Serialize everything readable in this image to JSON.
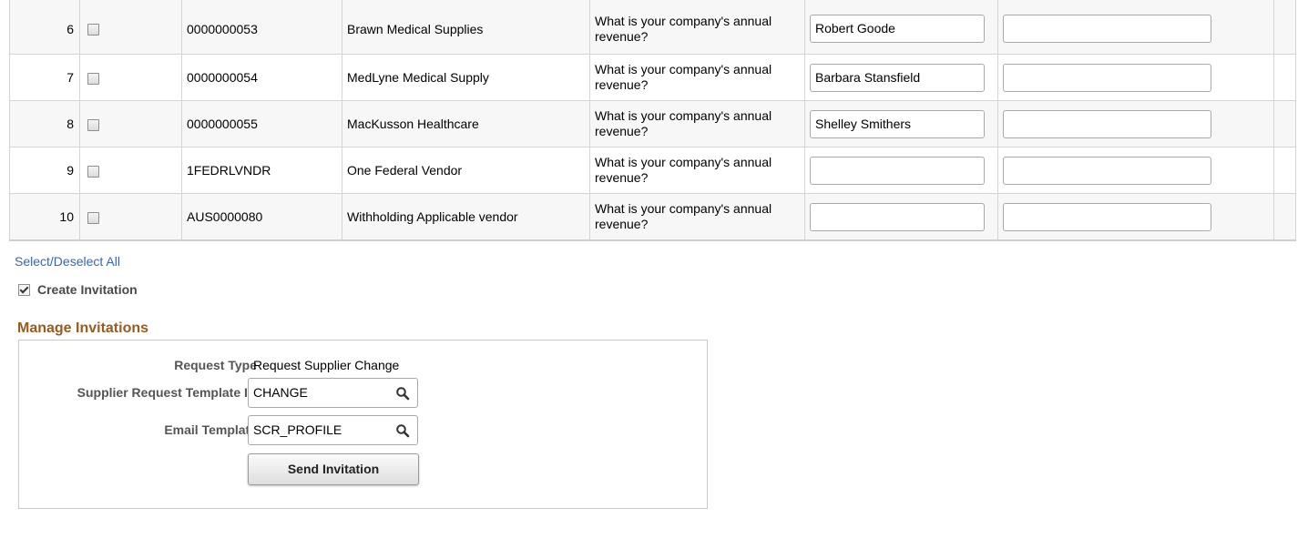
{
  "rows": [
    {
      "num": "6",
      "supplier_id": "0000000053",
      "name": "Brawn Medical Supplies",
      "question": "What is your company's annual revenue?",
      "answer": "Robert Goode",
      "extra": ""
    },
    {
      "num": "7",
      "supplier_id": "0000000054",
      "name": "MedLyne Medical Supply",
      "question": "What is your company's annual revenue?",
      "answer": "Barbara Stansfield",
      "extra": ""
    },
    {
      "num": "8",
      "supplier_id": "0000000055",
      "name": "MacKusson Healthcare",
      "question": "What is your company's annual revenue?",
      "answer": "Shelley Smithers",
      "extra": ""
    },
    {
      "num": "9",
      "supplier_id": "1FEDRLVNDR",
      "name": "One Federal Vendor",
      "question": "What is your company's annual revenue?",
      "answer": "",
      "extra": ""
    },
    {
      "num": "10",
      "supplier_id": "AUS0000080",
      "name": "Withholding Applicable vendor",
      "question": "What is your company's annual revenue?",
      "answer": "",
      "extra": ""
    }
  ],
  "select_deselect_label": "Select/Deselect All",
  "create_invitation_label": "Create Invitation",
  "manage": {
    "title": "Manage Invitations",
    "request_type_label": "Request Type",
    "request_type_value": "Request Supplier Change",
    "template_id_label": "Supplier Request Template ID",
    "template_id_value": "CHANGE",
    "email_template_label": "Email Template",
    "email_template_value": "SCR_PROFILE",
    "send_button_label": "Send Invitation"
  },
  "icons": {
    "lookup": "search-icon"
  },
  "colors": {
    "link": "#3366bb",
    "section_title": "#9c5a1c"
  }
}
